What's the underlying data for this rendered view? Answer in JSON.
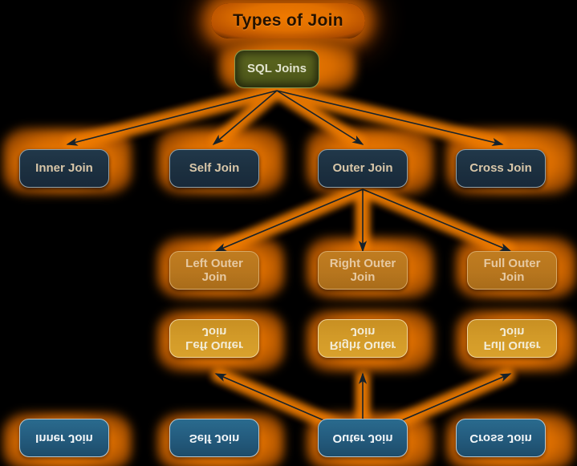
{
  "diagram": {
    "title": "Types of Join",
    "background_color": "#000000",
    "glow_color": "#e87c00",
    "root": {
      "label": "SQL Joins",
      "fill": "#545e1c",
      "text_color": "#e2e4cf"
    },
    "level2": {
      "fill": "#1c3040",
      "text_color": "#d8c6a8",
      "nodes": [
        {
          "label": "Inner Join"
        },
        {
          "label": "Self Join"
        },
        {
          "label": "Outer Join"
        },
        {
          "label": "Cross Join"
        }
      ]
    },
    "level3": {
      "fill": "#b7761e",
      "text_color": "#e6c9a2",
      "nodes": [
        {
          "label": "Left Outer\nJoin"
        },
        {
          "label": "Right Outer\nJoin"
        },
        {
          "label": "Full Outer\nJoin"
        }
      ]
    },
    "reflection_level3": {
      "fill": "#d29a28",
      "text_color": "#f3ecd6",
      "nodes": [
        {
          "label": "Left Outer\nJoin"
        },
        {
          "label": "Right Outer\nJoin"
        },
        {
          "label": "Full Outer\nJoin"
        }
      ]
    },
    "reflection_level2": {
      "fill": "#235a7c",
      "text_color": "#f2f6f8",
      "nodes": [
        {
          "label": "Inner Join"
        },
        {
          "label": "Self Join"
        },
        {
          "label": "Outer Join"
        },
        {
          "label": "Cross Join"
        }
      ]
    },
    "edges": [
      {
        "from": "SQL Joins",
        "to": "Inner Join"
      },
      {
        "from": "SQL Joins",
        "to": "Self Join"
      },
      {
        "from": "SQL Joins",
        "to": "Outer Join"
      },
      {
        "from": "SQL Joins",
        "to": "Cross Join"
      },
      {
        "from": "Outer Join",
        "to": "Left Outer Join"
      },
      {
        "from": "Outer Join",
        "to": "Right Outer Join"
      },
      {
        "from": "Outer Join",
        "to": "Full Outer Join"
      }
    ]
  }
}
